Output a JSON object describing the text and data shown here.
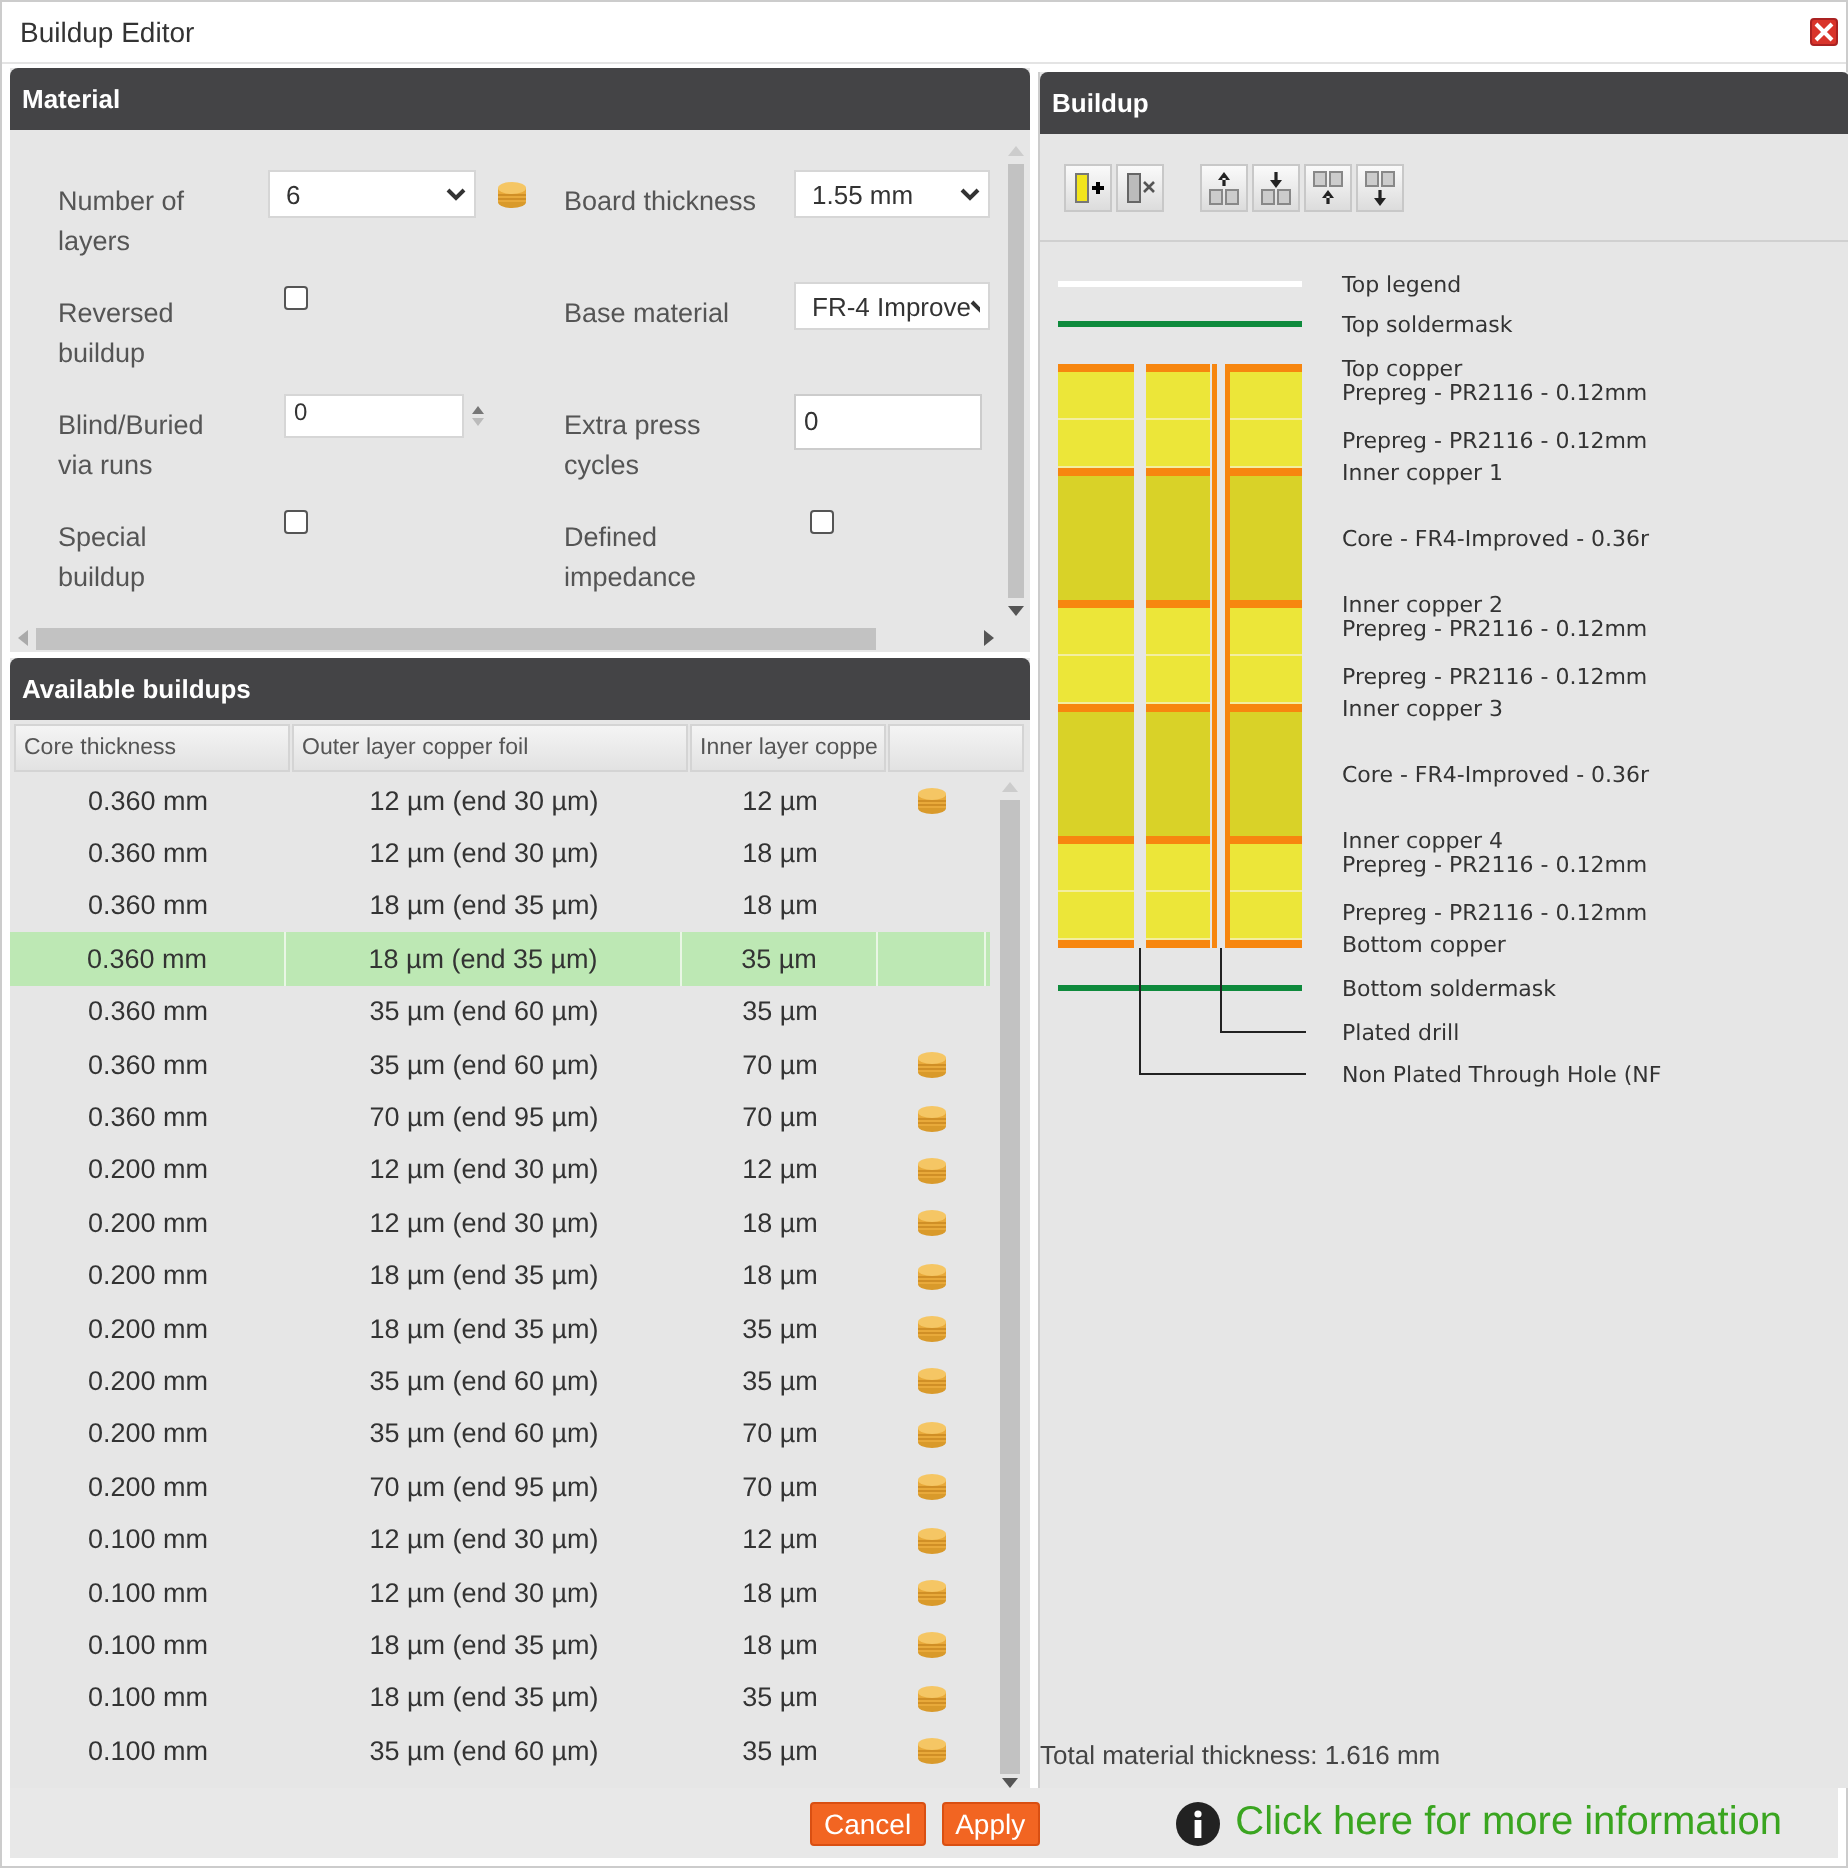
{
  "window": {
    "title": "Buildup Editor"
  },
  "material": {
    "title": "Material",
    "fields": [
      {
        "label": "Number of layers",
        "kind": "select",
        "value": "6",
        "cost": true
      },
      {
        "label": "Board thickness",
        "kind": "select",
        "value": "1.55 mm",
        "cost": false
      },
      {
        "label": "Reversed buildup",
        "kind": "checkbox",
        "checked": false
      },
      {
        "label": "Base material",
        "kind": "select",
        "value": "FR-4 Improve",
        "cost": false
      },
      {
        "label": "Blind/Buried via runs",
        "kind": "spin",
        "value": "0"
      },
      {
        "label": "Extra press cycles",
        "kind": "text",
        "value": "0"
      },
      {
        "label": "Special buildup",
        "kind": "checkbox",
        "checked": false
      },
      {
        "label": "Defined impedance",
        "kind": "checkbox",
        "checked": false
      }
    ]
  },
  "available": {
    "title": "Available buildups",
    "columns": [
      "Core thickness",
      "Outer layer copper foil",
      "Inner layer coppe"
    ],
    "rows": [
      {
        "cells": [
          "0.360 mm",
          "12 µm (end 30 µm)",
          "12 µm"
        ],
        "cost": true,
        "selected": false
      },
      {
        "cells": [
          "0.360 mm",
          "12 µm (end 30 µm)",
          "18 µm"
        ],
        "cost": false,
        "selected": false
      },
      {
        "cells": [
          "0.360 mm",
          "18 µm (end 35 µm)",
          "18 µm"
        ],
        "cost": false,
        "selected": false
      },
      {
        "cells": [
          "0.360 mm",
          "18 µm (end 35 µm)",
          "35 µm"
        ],
        "cost": false,
        "selected": true
      },
      {
        "cells": [
          "0.360 mm",
          "35 µm (end 60 µm)",
          "35 µm"
        ],
        "cost": false,
        "selected": false
      },
      {
        "cells": [
          "0.360 mm",
          "35 µm (end 60 µm)",
          "70 µm"
        ],
        "cost": true,
        "selected": false
      },
      {
        "cells": [
          "0.360 mm",
          "70 µm (end 95 µm)",
          "70 µm"
        ],
        "cost": true,
        "selected": false
      },
      {
        "cells": [
          "0.200 mm",
          "12 µm (end 30 µm)",
          "12 µm"
        ],
        "cost": true,
        "selected": false
      },
      {
        "cells": [
          "0.200 mm",
          "12 µm (end 30 µm)",
          "18 µm"
        ],
        "cost": true,
        "selected": false
      },
      {
        "cells": [
          "0.200 mm",
          "18 µm (end 35 µm)",
          "18 µm"
        ],
        "cost": true,
        "selected": false
      },
      {
        "cells": [
          "0.200 mm",
          "18 µm (end 35 µm)",
          "35 µm"
        ],
        "cost": true,
        "selected": false
      },
      {
        "cells": [
          "0.200 mm",
          "35 µm (end 60 µm)",
          "35 µm"
        ],
        "cost": true,
        "selected": false
      },
      {
        "cells": [
          "0.200 mm",
          "35 µm (end 60 µm)",
          "70 µm"
        ],
        "cost": true,
        "selected": false
      },
      {
        "cells": [
          "0.200 mm",
          "70 µm (end 95 µm)",
          "70 µm"
        ],
        "cost": true,
        "selected": false
      },
      {
        "cells": [
          "0.100 mm",
          "12 µm (end 30 µm)",
          "12 µm"
        ],
        "cost": true,
        "selected": false
      },
      {
        "cells": [
          "0.100 mm",
          "12 µm (end 30 µm)",
          "18 µm"
        ],
        "cost": true,
        "selected": false
      },
      {
        "cells": [
          "0.100 mm",
          "18 µm (end 35 µm)",
          "18 µm"
        ],
        "cost": true,
        "selected": false
      },
      {
        "cells": [
          "0.100 mm",
          "18 µm (end 35 µm)",
          "35 µm"
        ],
        "cost": true,
        "selected": false
      },
      {
        "cells": [
          "0.100 mm",
          "35 µm (end 60 µm)",
          "35 µm"
        ],
        "cost": true,
        "selected": false
      }
    ]
  },
  "buildup": {
    "title": "Buildup",
    "layers": [
      {
        "label": "Top legend",
        "kind": "legend"
      },
      {
        "label": "Top soldermask",
        "kind": "soldermask"
      },
      {
        "label": "Top copper",
        "kind": "copper"
      },
      {
        "label": "Prepreg - PR2116 - 0.12mm",
        "kind": "prepreg"
      },
      {
        "label": "Prepreg - PR2116 - 0.12mm",
        "kind": "prepreg"
      },
      {
        "label": "Inner copper 1",
        "kind": "copper"
      },
      {
        "label": "Core - FR4-Improved - 0.36r",
        "kind": "core"
      },
      {
        "label": "Inner copper 2",
        "kind": "copper"
      },
      {
        "label": "Prepreg - PR2116 - 0.12mm",
        "kind": "prepreg"
      },
      {
        "label": "Prepreg - PR2116 - 0.12mm",
        "kind": "prepreg"
      },
      {
        "label": "Inner copper 3",
        "kind": "copper"
      },
      {
        "label": "Core - FR4-Improved - 0.36r",
        "kind": "core"
      },
      {
        "label": "Inner copper 4",
        "kind": "copper"
      },
      {
        "label": "Prepreg - PR2116 - 0.12mm",
        "kind": "prepreg"
      },
      {
        "label": "Prepreg - PR2116 - 0.12mm",
        "kind": "prepreg"
      },
      {
        "label": "Bottom copper",
        "kind": "copper"
      },
      {
        "label": "Bottom soldermask",
        "kind": "soldermask"
      },
      {
        "label": "Plated drill",
        "kind": "plated_drill"
      },
      {
        "label": "Non Plated Through Hole (NF",
        "kind": "npth"
      }
    ],
    "total": "Total material thickness: 1.616 mm"
  },
  "footer": {
    "cancel": "Cancel",
    "apply": "Apply",
    "info_link": "Click here for more information"
  }
}
